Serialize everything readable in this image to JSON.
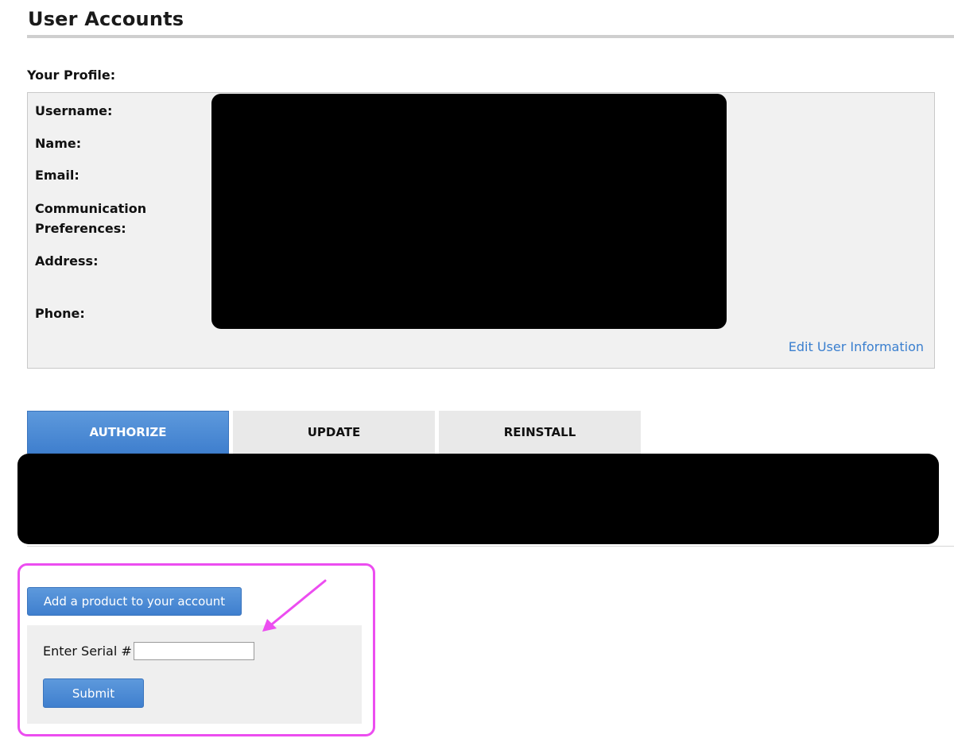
{
  "page": {
    "title": "User Accounts"
  },
  "profile": {
    "section_label": "Your Profile:",
    "fields": [
      {
        "label": "Username:"
      },
      {
        "label": "Name:"
      },
      {
        "label": "Email:"
      },
      {
        "label": "Communication Preferences:"
      },
      {
        "label": "Address:"
      },
      {
        "label": "Phone:"
      }
    ],
    "edit_link": "Edit User Information"
  },
  "tabs": [
    {
      "label": "AUTHORIZE",
      "active": true
    },
    {
      "label": "UPDATE",
      "active": false
    },
    {
      "label": "REINSTALL",
      "active": false
    }
  ],
  "add_product": {
    "button_label": "Add a product to your account",
    "serial_label": "Enter Serial #",
    "serial_value": "",
    "submit_label": "Submit"
  },
  "colors": {
    "accent_blue": "#4a8ad6",
    "link_blue": "#3a7fcf",
    "highlight_magenta": "#ec4df0",
    "panel_gray": "#f1f1f1"
  },
  "icons": {
    "annotation": "arrow-annotation-icon"
  }
}
